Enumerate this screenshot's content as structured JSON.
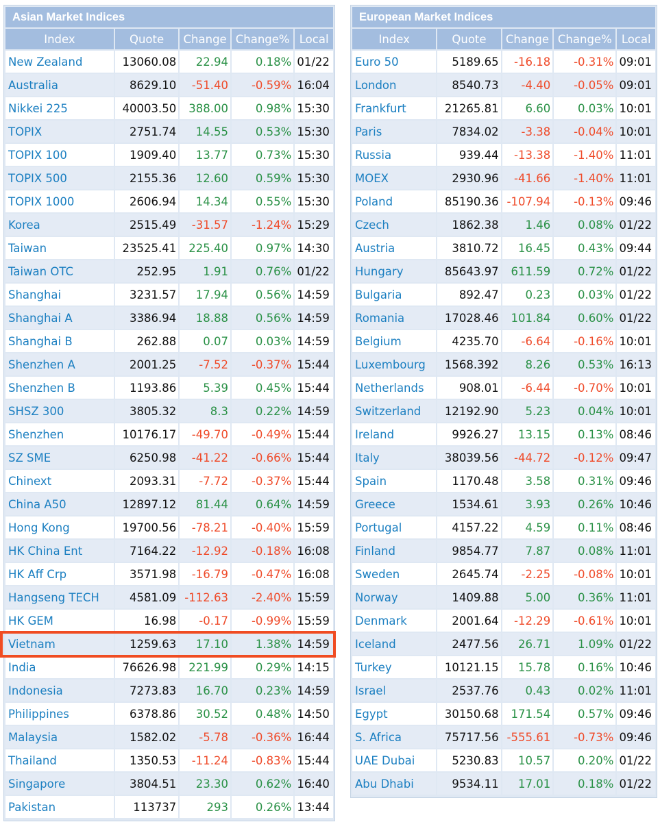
{
  "asian": {
    "title": "Asian Market Indices",
    "headers": [
      "Index",
      "Quote",
      "Change",
      "Change%",
      "Local"
    ],
    "rows": [
      [
        "New Zealand",
        "13060.08",
        "22.94",
        "0.18%",
        "01/22"
      ],
      [
        "Australia",
        "8629.10",
        "-51.40",
        "-0.59%",
        "16:04"
      ],
      [
        "Nikkei 225",
        "40003.50",
        "388.00",
        "0.98%",
        "15:30"
      ],
      [
        "TOPIX",
        "2751.74",
        "14.55",
        "0.53%",
        "15:30"
      ],
      [
        "TOPIX 100",
        "1909.40",
        "13.77",
        "0.73%",
        "15:30"
      ],
      [
        "TOPIX 500",
        "2155.36",
        "12.60",
        "0.59%",
        "15:30"
      ],
      [
        "TOPIX 1000",
        "2606.94",
        "14.34",
        "0.55%",
        "15:30"
      ],
      [
        "Korea",
        "2515.49",
        "-31.57",
        "-1.24%",
        "15:29"
      ],
      [
        "Taiwan",
        "23525.41",
        "225.40",
        "0.97%",
        "14:30"
      ],
      [
        "Taiwan OTC",
        "252.95",
        "1.91",
        "0.76%",
        "01/22"
      ],
      [
        "Shanghai",
        "3231.57",
        "17.94",
        "0.56%",
        "14:59"
      ],
      [
        "Shanghai A",
        "3386.94",
        "18.88",
        "0.56%",
        "14:59"
      ],
      [
        "Shanghai B",
        "262.88",
        "0.07",
        "0.03%",
        "14:59"
      ],
      [
        "Shenzhen A",
        "2001.25",
        "-7.52",
        "-0.37%",
        "15:44"
      ],
      [
        "Shenzhen B",
        "1193.86",
        "5.39",
        "0.45%",
        "15:44"
      ],
      [
        "SHSZ 300",
        "3805.32",
        "8.3",
        "0.22%",
        "14:59"
      ],
      [
        "Shenzhen",
        "10176.17",
        "-49.70",
        "-0.49%",
        "15:44"
      ],
      [
        "SZ SME",
        "6250.98",
        "-41.22",
        "-0.66%",
        "15:44"
      ],
      [
        "Chinext",
        "2093.31",
        "-7.72",
        "-0.37%",
        "15:44"
      ],
      [
        "China A50",
        "12897.12",
        "81.44",
        "0.64%",
        "14:59"
      ],
      [
        "Hong Kong",
        "19700.56",
        "-78.21",
        "-0.40%",
        "15:59"
      ],
      [
        "HK China Ent",
        "7164.22",
        "-12.92",
        "-0.18%",
        "16:08"
      ],
      [
        "HK Aff Crp",
        "3571.98",
        "-16.79",
        "-0.47%",
        "16:08"
      ],
      [
        "Hangseng TECH",
        "4581.09",
        "-112.63",
        "-2.40%",
        "15:59"
      ],
      [
        "HK GEM",
        "16.98",
        "-0.17",
        "-0.99%",
        "15:59"
      ],
      [
        "Vietnam",
        "1259.63",
        "17.10",
        "1.38%",
        "14:59"
      ],
      [
        "India",
        "76626.98",
        "221.99",
        "0.29%",
        "14:15"
      ],
      [
        "Indonesia",
        "7273.83",
        "16.70",
        "0.23%",
        "14:59"
      ],
      [
        "Philippines",
        "6378.86",
        "30.52",
        "0.48%",
        "14:50"
      ],
      [
        "Malaysia",
        "1582.02",
        "-5.78",
        "-0.36%",
        "16:44"
      ],
      [
        "Thailand",
        "1350.53",
        "-11.24",
        "-0.83%",
        "15:44"
      ],
      [
        "Singapore",
        "3804.51",
        "23.30",
        "0.62%",
        "16:40"
      ],
      [
        "Pakistan",
        "113737",
        "293",
        "0.26%",
        "13:44"
      ]
    ],
    "highlighted_row": "Vietnam"
  },
  "european": {
    "title": "European Market Indices",
    "headers": [
      "Index",
      "Quote",
      "Change",
      "Change%",
      "Local"
    ],
    "rows": [
      [
        "Euro 50",
        "5189.65",
        "-16.18",
        "-0.31%",
        "09:01"
      ],
      [
        "London",
        "8540.73",
        "-4.40",
        "-0.05%",
        "09:01"
      ],
      [
        "Frankfurt",
        "21265.81",
        "6.60",
        "0.03%",
        "10:01"
      ],
      [
        "Paris",
        "7834.02",
        "-3.38",
        "-0.04%",
        "10:01"
      ],
      [
        "Russia",
        "939.44",
        "-13.38",
        "-1.40%",
        "11:01"
      ],
      [
        "MOEX",
        "2930.96",
        "-41.66",
        "-1.40%",
        "11:01"
      ],
      [
        "Poland",
        "85190.36",
        "-107.94",
        "-0.13%",
        "09:46"
      ],
      [
        "Czech",
        "1862.38",
        "1.46",
        "0.08%",
        "01/22"
      ],
      [
        "Austria",
        "3810.72",
        "16.45",
        "0.43%",
        "09:44"
      ],
      [
        "Hungary",
        "85643.97",
        "611.59",
        "0.72%",
        "01/22"
      ],
      [
        "Bulgaria",
        "892.47",
        "0.23",
        "0.03%",
        "01/22"
      ],
      [
        "Romania",
        "17028.46",
        "101.84",
        "0.60%",
        "01/22"
      ],
      [
        "Belgium",
        "4235.70",
        "-6.64",
        "-0.16%",
        "10:01"
      ],
      [
        "Luxembourg",
        "1568.392",
        "8.26",
        "0.53%",
        "16:13"
      ],
      [
        "Netherlands",
        "908.01",
        "-6.44",
        "-0.70%",
        "10:01"
      ],
      [
        "Switzerland",
        "12192.90",
        "5.23",
        "0.04%",
        "10:01"
      ],
      [
        "Ireland",
        "9926.27",
        "13.15",
        "0.13%",
        "08:46"
      ],
      [
        "Italy",
        "38039.56",
        "-44.72",
        "-0.12%",
        "09:47"
      ],
      [
        "Spain",
        "1170.48",
        "3.58",
        "0.31%",
        "09:46"
      ],
      [
        "Greece",
        "1534.61",
        "3.93",
        "0.26%",
        "10:46"
      ],
      [
        "Portugal",
        "4157.22",
        "4.59",
        "0.11%",
        "08:46"
      ],
      [
        "Finland",
        "9854.77",
        "7.87",
        "0.08%",
        "11:01"
      ],
      [
        "Sweden",
        "2645.74",
        "-2.25",
        "-0.08%",
        "10:01"
      ],
      [
        "Norway",
        "1409.88",
        "5.00",
        "0.36%",
        "11:01"
      ],
      [
        "Denmark",
        "2001.64",
        "-12.29",
        "-0.61%",
        "10:01"
      ],
      [
        "Iceland",
        "2477.56",
        "26.71",
        "1.09%",
        "01/22"
      ],
      [
        "Turkey",
        "10121.15",
        "15.78",
        "0.16%",
        "10:46"
      ],
      [
        "Israel",
        "2537.76",
        "0.43",
        "0.02%",
        "11:01"
      ],
      [
        "Egypt",
        "30150.68",
        "171.54",
        "0.57%",
        "09:46"
      ],
      [
        "S. Africa",
        "75717.56",
        "-555.61",
        "-0.73%",
        "09:46"
      ],
      [
        "UAE Dubai",
        "5230.83",
        "10.57",
        "0.20%",
        "01/22"
      ],
      [
        "Abu Dhabi",
        "9534.11",
        "17.01",
        "0.18%",
        "01/22"
      ]
    ]
  },
  "colors": {
    "header_bg": "#a3bddf",
    "index_link": "#1b7fc1",
    "positive": "#2a9146",
    "negative": "#ef4b2a",
    "row_alt": "#e4ebf5",
    "highlight_border": "#f04c22"
  }
}
